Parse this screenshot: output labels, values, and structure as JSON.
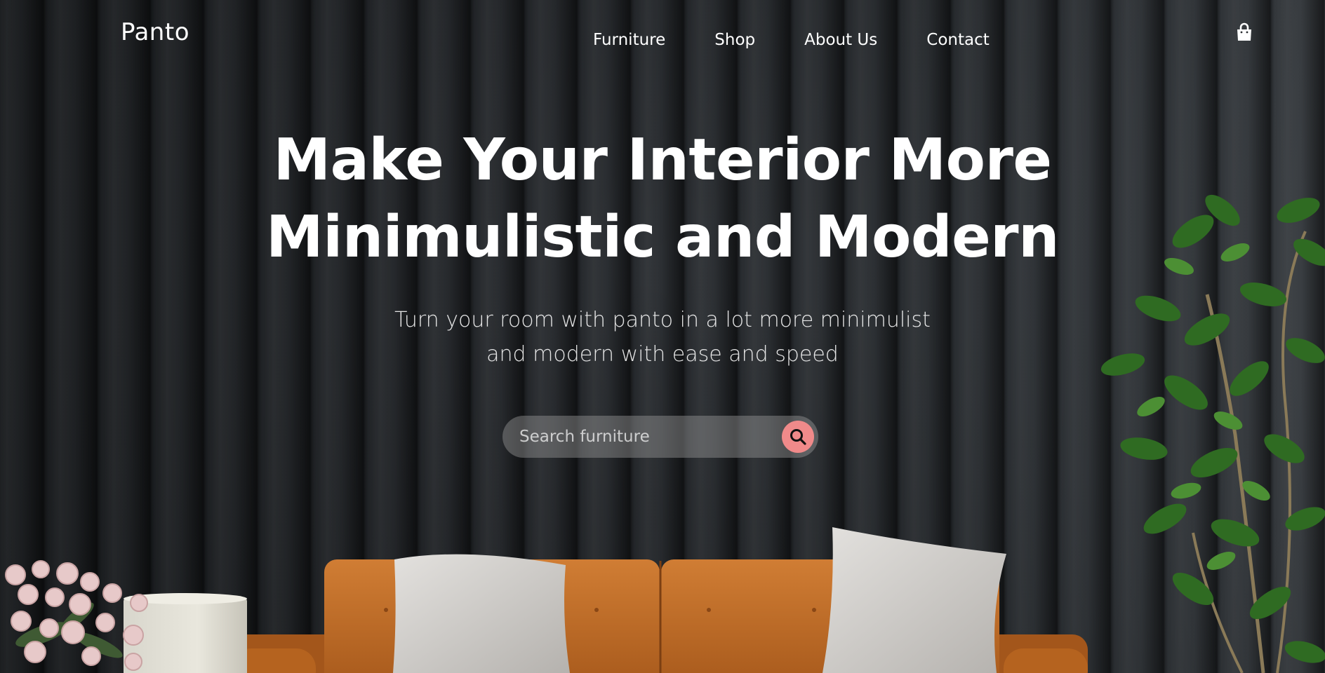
{
  "brand": {
    "name": "Panto"
  },
  "nav": {
    "items": [
      {
        "label": "Furniture"
      },
      {
        "label": "Shop"
      },
      {
        "label": "About Us"
      },
      {
        "label": "Contact"
      }
    ],
    "cart_icon": "shopping-bag-icon"
  },
  "hero": {
    "title_line1": "Make Your Interior More",
    "title_line2": "Minimulistic and Modern",
    "subtitle_line1": "Turn your room with panto in a lot more minimulist",
    "subtitle_line2": "and modern with ease and speed"
  },
  "search": {
    "placeholder": "Search furniture",
    "value": "",
    "button_icon": "search-icon"
  },
  "colors": {
    "accent": "#f08a8a",
    "background": "#24272b",
    "sofa": "#c9762e",
    "text": "#ffffff"
  }
}
